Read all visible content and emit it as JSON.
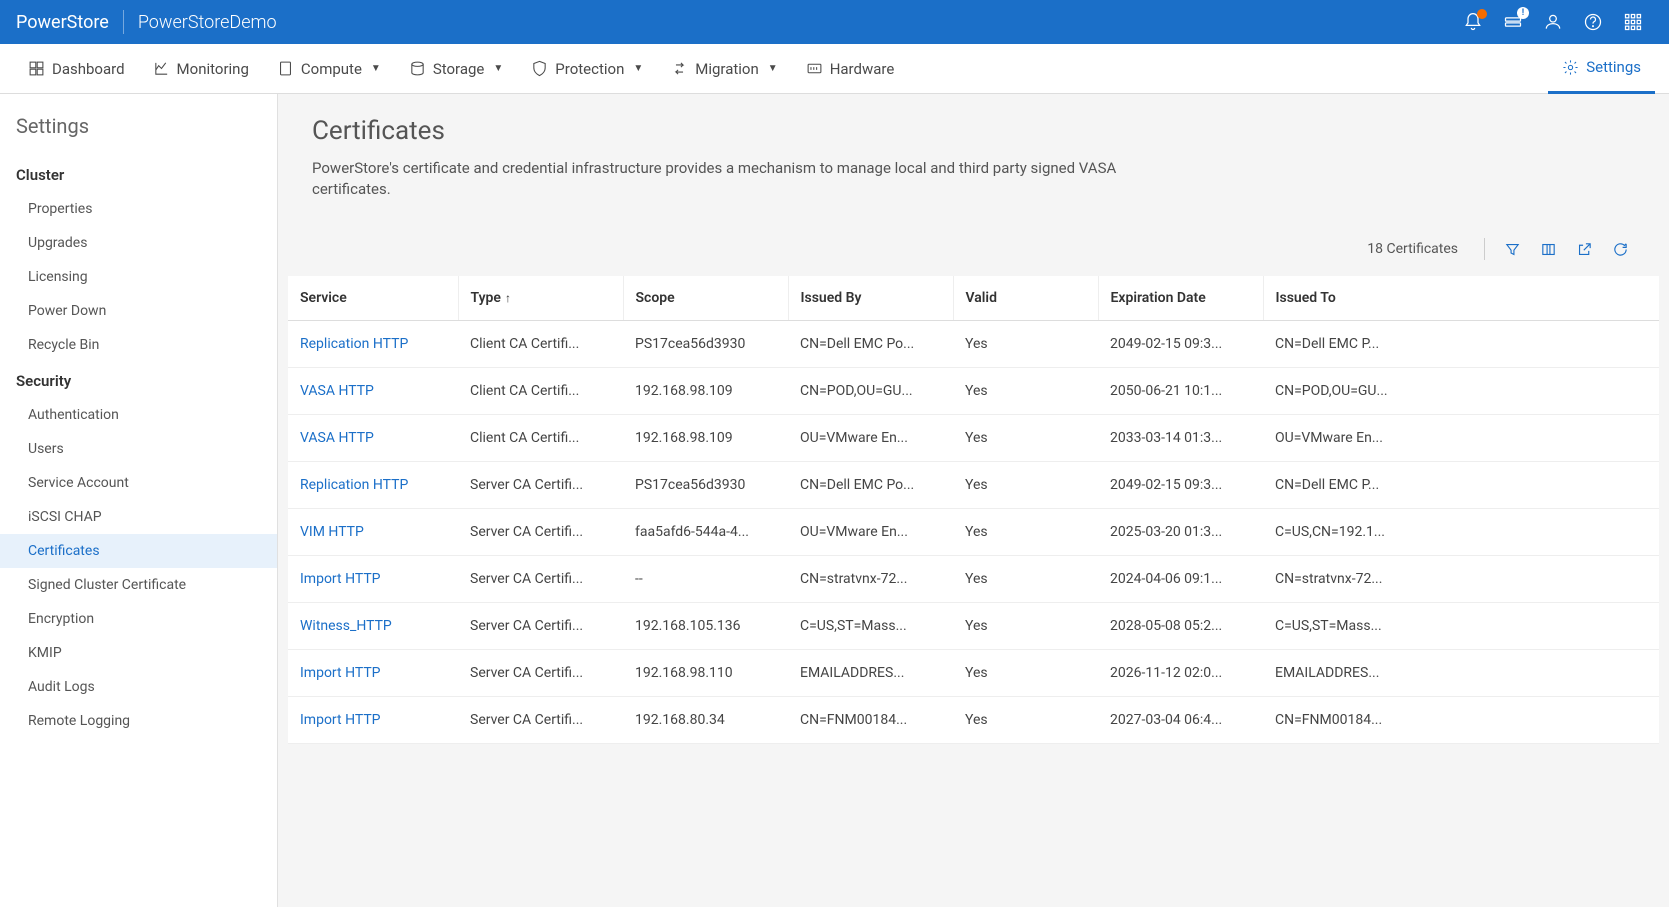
{
  "header": {
    "brand": "PowerStore",
    "appname": "PowerStoreDemo"
  },
  "nav": {
    "dashboard": "Dashboard",
    "monitoring": "Monitoring",
    "compute": "Compute",
    "storage": "Storage",
    "protection": "Protection",
    "migration": "Migration",
    "hardware": "Hardware",
    "settings": "Settings"
  },
  "sidebar": {
    "title": "Settings",
    "sections": {
      "cluster": {
        "label": "Cluster",
        "items": {
          "properties": "Properties",
          "upgrades": "Upgrades",
          "licensing": "Licensing",
          "powerdown": "Power Down",
          "recyclebin": "Recycle Bin"
        }
      },
      "security": {
        "label": "Security",
        "items": {
          "authentication": "Authentication",
          "users": "Users",
          "serviceaccount": "Service Account",
          "iscsichap": "iSCSI CHAP",
          "certificates": "Certificates",
          "signedcert": "Signed Cluster Certificate",
          "encryption": "Encryption",
          "kmip": "KMIP",
          "auditlogs": "Audit Logs",
          "remotelogging": "Remote Logging"
        }
      }
    }
  },
  "page": {
    "title": "Certificates",
    "description": "PowerStore's certificate and credential infrastructure provides a mechanism to manage local and third party signed VASA certificates.",
    "count_label": "18 Certificates"
  },
  "table": {
    "columns": {
      "service": "Service",
      "type": "Type",
      "scope": "Scope",
      "issued_by": "Issued By",
      "valid": "Valid",
      "expiration": "Expiration Date",
      "issued_to": "Issued To"
    },
    "rows": [
      {
        "service": "Replication HTTP",
        "type": "Client CA Certifi...",
        "scope": "PS17cea56d3930",
        "issued_by": "CN=Dell EMC Po...",
        "valid": "Yes",
        "expiration": "2049-02-15 09:3...",
        "issued_to": "CN=Dell EMC P..."
      },
      {
        "service": "VASA HTTP",
        "type": "Client CA Certifi...",
        "scope": "192.168.98.109",
        "issued_by": "CN=POD,OU=GU...",
        "valid": "Yes",
        "expiration": "2050-06-21 10:1...",
        "issued_to": "CN=POD,OU=GU..."
      },
      {
        "service": "VASA HTTP",
        "type": "Client CA Certifi...",
        "scope": "192.168.98.109",
        "issued_by": "OU=VMware En...",
        "valid": "Yes",
        "expiration": "2033-03-14 01:3...",
        "issued_to": "OU=VMware En..."
      },
      {
        "service": "Replication HTTP",
        "type": "Server CA Certifi...",
        "scope": "PS17cea56d3930",
        "issued_by": "CN=Dell EMC Po...",
        "valid": "Yes",
        "expiration": "2049-02-15 09:3...",
        "issued_to": "CN=Dell EMC P..."
      },
      {
        "service": "VIM HTTP",
        "type": "Server CA Certifi...",
        "scope": "faa5afd6-544a-4...",
        "issued_by": "OU=VMware En...",
        "valid": "Yes",
        "expiration": "2025-03-20 01:3...",
        "issued_to": "C=US,CN=192.1..."
      },
      {
        "service": "Import HTTP",
        "type": "Server CA Certifi...",
        "scope": "--",
        "issued_by": "CN=stratvnx-72...",
        "valid": "Yes",
        "expiration": "2024-04-06 09:1...",
        "issued_to": "CN=stratvnx-72..."
      },
      {
        "service": "Witness_HTTP",
        "type": "Server CA Certifi...",
        "scope": "192.168.105.136",
        "issued_by": "C=US,ST=Mass...",
        "valid": "Yes",
        "expiration": "2028-05-08 05:2...",
        "issued_to": "C=US,ST=Mass..."
      },
      {
        "service": "Import HTTP",
        "type": "Server CA Certifi...",
        "scope": "192.168.98.110",
        "issued_by": "EMAILADDRES...",
        "valid": "Yes",
        "expiration": "2026-11-12 02:0...",
        "issued_to": "EMAILADDRES..."
      },
      {
        "service": "Import HTTP",
        "type": "Server CA Certifi...",
        "scope": "192.168.80.34",
        "issued_by": "CN=FNM00184...",
        "valid": "Yes",
        "expiration": "2027-03-04 06:4...",
        "issued_to": "CN=FNM00184..."
      }
    ]
  }
}
